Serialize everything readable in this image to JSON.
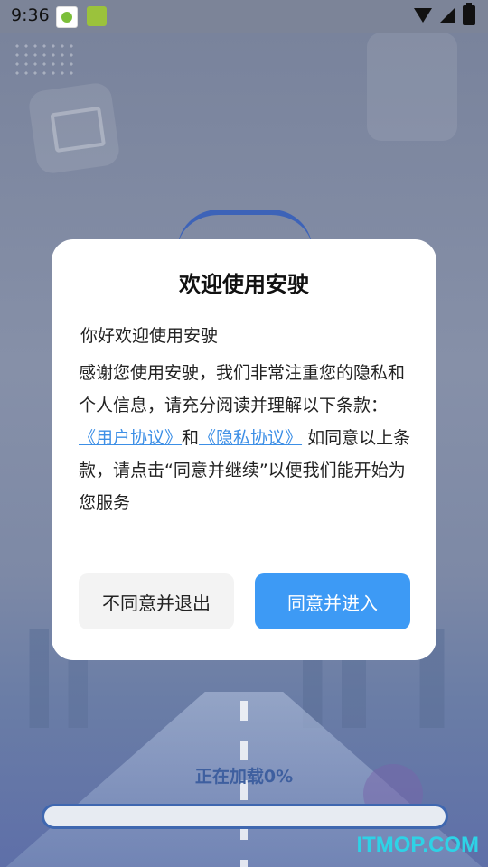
{
  "status_bar": {
    "time": "9:36",
    "icons": [
      "app-icon-yk",
      "app-icon-green",
      "wifi-icon",
      "signal-icon",
      "battery-icon"
    ]
  },
  "dialog": {
    "title": "欢迎使用安驶",
    "greeting": "你好欢迎使用安驶",
    "body_intro": "感谢您使用安驶，我们非常注重您的隐私和个人信息，请充分阅读并理解以下条款：",
    "user_agreement_link": "《用户协议》",
    "conjunction": "和",
    "privacy_link": "《隐私协议》",
    "body_outro": "如同意以上条款，请点击“同意并继续”以便我们能开始为您服务",
    "decline_button": "不同意并退出",
    "accept_button": "同意并进入"
  },
  "loading": {
    "text": "正在加载0%",
    "progress": 0
  },
  "watermark": "ITMOP.COM",
  "colors": {
    "accent": "#3d9af5",
    "link": "#3d8fe6",
    "progress": "#3f67b0",
    "watermark": "#2ed2e6"
  }
}
